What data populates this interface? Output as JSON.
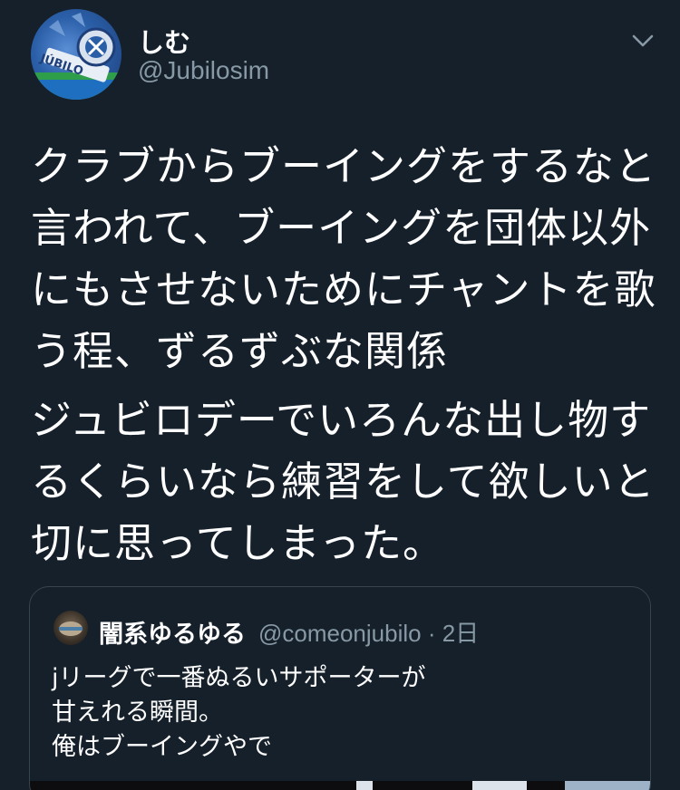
{
  "user": {
    "display_name": "しむ",
    "handle": "@Jubilosim",
    "avatar_text": "JÚBILO"
  },
  "tweet": {
    "paragraphs": [
      "クラブからブーイングをするなと\n言われて、ブーイングを団体以外\nにもさせないためにチャントを歌\nう程、ずるずぶな関係",
      "ジュビロデーでいろんな出し物す\nるくらいなら練習をして欲しいと\n切に思ってしまった。"
    ]
  },
  "quoted": {
    "display_name": "闇系ゆるゆる",
    "meta": "@comeonjubilo · 2日",
    "text": "jリーグで一番ぬるいサポーターが\n甘えれる瞬間。\n俺はブーイングやで"
  },
  "colors": {
    "background": "#15202b",
    "secondary_text": "#8899a6",
    "border": "#38444d"
  },
  "icons": {
    "menu": "chevron-down-icon"
  }
}
